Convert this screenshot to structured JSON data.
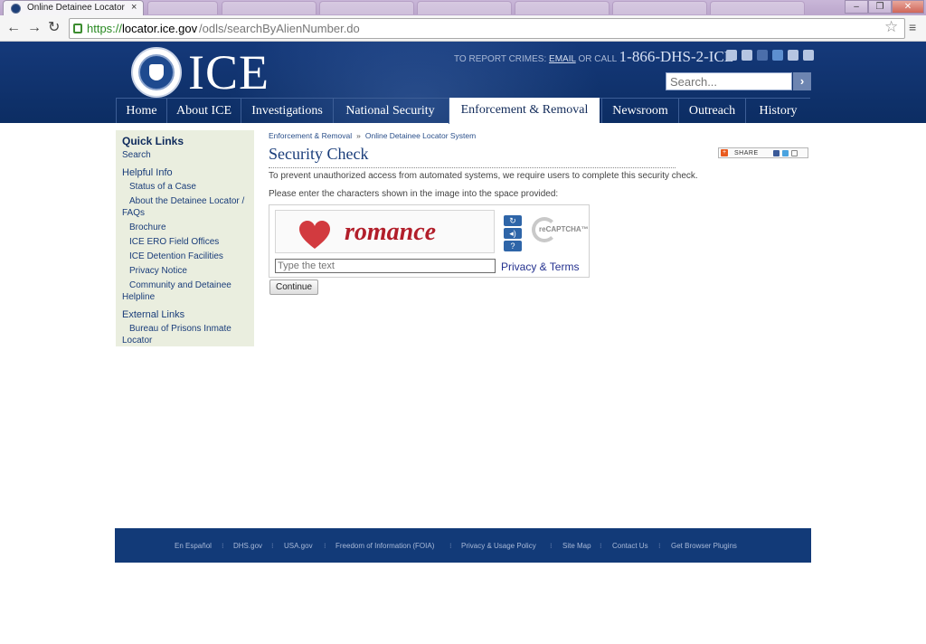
{
  "browser": {
    "tab_title": "Online Detainee Locator S",
    "tab_close": "×",
    "url_scheme": "https://",
    "url_host": "locator.ice.gov",
    "url_path": "/odls/searchByAlienNumber.do",
    "back_glyph": "←",
    "forward_glyph": "→",
    "reload_glyph": "↻",
    "star_glyph": "☆",
    "menu_glyph": "≡",
    "minimize_glyph": "–",
    "maximize_glyph": "❐",
    "close_glyph": "✕"
  },
  "header": {
    "logo_text": "ICE",
    "report_prefix": "TO REPORT CRIMES: ",
    "report_email": "EMAIL",
    "report_or_call": " OR CALL ",
    "report_phone": "1-866-DHS-2-ICE",
    "search_placeholder": "Search...",
    "search_button": "›",
    "social_icons": [
      "email-icon",
      "print-icon",
      "facebook-icon",
      "twitter-icon",
      "podcast-icon",
      "rss-icon"
    ]
  },
  "nav": {
    "items": [
      "Home",
      "About ICE",
      "Investigations",
      "National Security",
      "Enforcement & Removal",
      "Newsroom",
      "Outreach",
      "History"
    ],
    "active": "Enforcement & Removal"
  },
  "sidebar": {
    "quick_links_heading": "Quick Links",
    "search": "Search",
    "helpful_info_heading": "Helpful Info",
    "helpful_items": [
      "Status of a Case",
      "About the Detainee Locator / FAQs",
      "Brochure",
      "ICE ERO Field Offices",
      "ICE Detention Facilities",
      "Privacy Notice",
      "Community and Detainee Helpline"
    ],
    "external_heading": "External Links",
    "external_items": [
      "Bureau of Prisons Inmate Locator"
    ]
  },
  "main": {
    "breadcrumb": [
      "Enforcement & Removal",
      "Online Detainee Locator System"
    ],
    "breadcrumb_sep": "»",
    "share_label": "SHARE",
    "title": "Security Check",
    "paragraph1": "To prevent unauthorized access from automated systems, we require users to complete this security check.",
    "paragraph2": "Please enter the characters shown in the image into the space provided:",
    "continue_label": "Continue"
  },
  "captcha": {
    "word": "romance",
    "input_placeholder": "Type the text",
    "privacy_link": "Privacy & Terms",
    "logo_text": "reCAPTCHA™",
    "reload_glyph": "↻",
    "audio_glyph": "◂)",
    "help_glyph": "?",
    "heart_color": "#d23a3f"
  },
  "footer": {
    "links": [
      "En Español",
      "DHS.gov",
      "USA.gov",
      "Freedom of Information (FOIA)",
      "Privacy & Usage Policy",
      "Site Map",
      "Contact Us",
      "Get Browser Plugins"
    ],
    "separator": "⁝"
  }
}
